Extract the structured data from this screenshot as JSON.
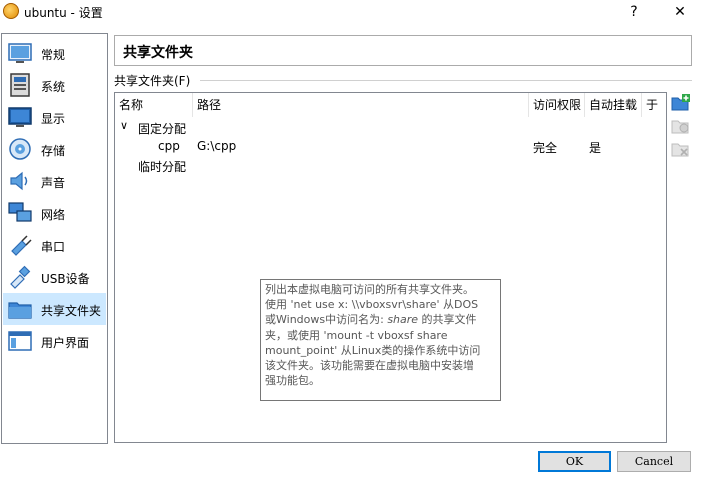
{
  "window": {
    "title": "ubuntu - 设置",
    "help_glyph": "?",
    "close_glyph": "✕"
  },
  "sidebar": {
    "items": [
      {
        "label": "常规",
        "icon": "general-icon"
      },
      {
        "label": "系统",
        "icon": "system-icon"
      },
      {
        "label": "显示",
        "icon": "display-icon"
      },
      {
        "label": "存储",
        "icon": "storage-icon"
      },
      {
        "label": "声音",
        "icon": "audio-icon"
      },
      {
        "label": "网络",
        "icon": "network-icon"
      },
      {
        "label": "串口",
        "icon": "serial-port-icon"
      },
      {
        "label": "USB设备",
        "icon": "usb-icon"
      },
      {
        "label": "共享文件夹",
        "icon": "shared-folder-icon",
        "selected": true
      },
      {
        "label": "用户界面",
        "icon": "user-interface-icon"
      }
    ]
  },
  "page": {
    "title": "共享文件夹",
    "group_label": "共享文件夹(F)",
    "columns": [
      "名称",
      "路径",
      "访问权限",
      "自动挂载",
      "于"
    ],
    "rows": [
      {
        "expander": "∨",
        "name": "固定分配",
        "path": "",
        "access": "",
        "automount": ""
      },
      {
        "expander": "",
        "name": "cpp",
        "path": "G:\\cpp",
        "access": "完全",
        "automount": "是"
      },
      {
        "expander": "",
        "name": "临时分配",
        "path": "",
        "access": "",
        "automount": ""
      }
    ],
    "tooltip": {
      "line1": "列出本虚拟电脑可访问的所有共享文件夹。",
      "line2": "使用 'net use x: \\\\vboxsvr\\share' 从DOS",
      "line3a": "或Windows中访问名为: ",
      "line3b": "share",
      "line3c": " 的共享文件",
      "line4": "夹，或使用 'mount -t vboxsf share",
      "line5": "mount_point' 从Linux类的操作系统中访问",
      "line6": "该文件夹。该功能需要在虚拟电脑中安装增",
      "line7": "强功能包。"
    }
  },
  "buttons": {
    "ok": "OK",
    "cancel": "Cancel"
  },
  "colors": {
    "selection": "#cce8ff",
    "accent": "#0078d7"
  }
}
